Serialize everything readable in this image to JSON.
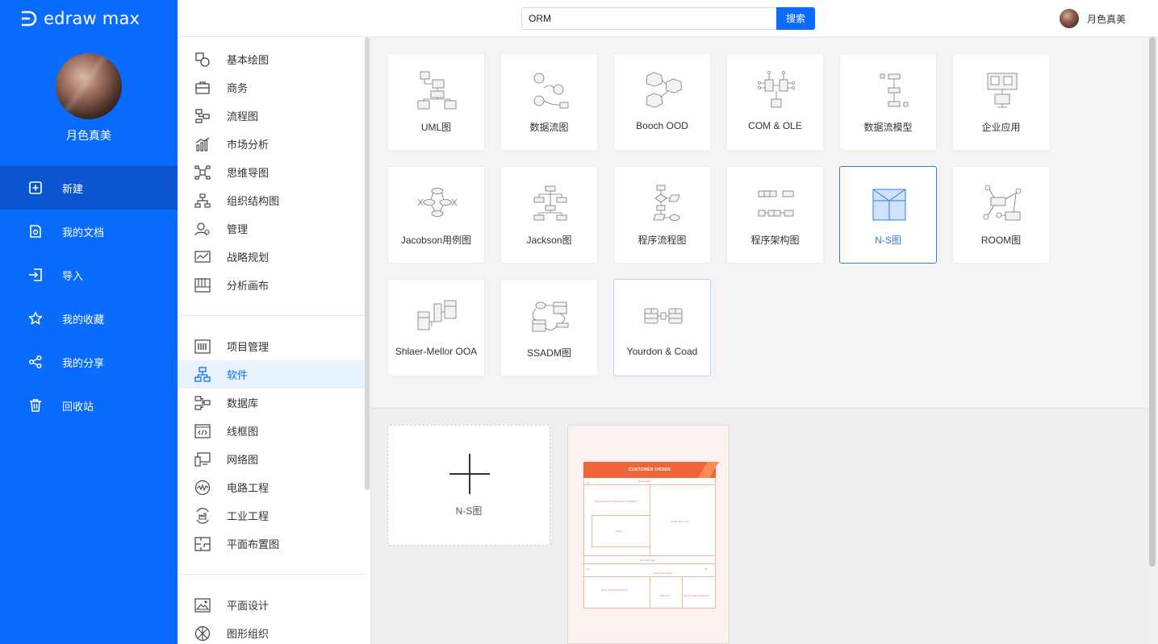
{
  "app": {
    "logo_text": "edraw max",
    "username": "月色真美"
  },
  "nav": {
    "items": [
      {
        "label": "新建",
        "icon": "new-file-icon",
        "active": true
      },
      {
        "label": "我的文档",
        "icon": "document-icon",
        "active": false
      },
      {
        "label": "导入",
        "icon": "import-icon",
        "active": false
      },
      {
        "label": "我的收藏",
        "icon": "star-icon",
        "active": false
      },
      {
        "label": "我的分享",
        "icon": "share-icon",
        "active": false
      },
      {
        "label": "回收站",
        "icon": "trash-icon",
        "active": false
      }
    ]
  },
  "topbar": {
    "search_value": "ORM",
    "search_button": "搜索",
    "username": "月色真美"
  },
  "categories": {
    "group1": [
      "基本绘图",
      "商务",
      "流程图",
      "市场分析",
      "思维导图",
      "组织结构图",
      "管理",
      "战略规划",
      "分析画布"
    ],
    "group2": [
      "项目管理",
      "软件",
      "数据库",
      "线框图",
      "网络图",
      "电路工程",
      "工业工程",
      "平面布置图"
    ],
    "group3": [
      "平面设计",
      "图形组织"
    ],
    "active": "软件"
  },
  "templates": {
    "row1": [
      "UML图",
      "数据流图",
      "Booch OOD",
      "COM & OLE",
      "数据流模型",
      "企业应用"
    ],
    "row2": [
      "Jacobson用例图",
      "Jackson图",
      "程序流程图",
      "程序架构图",
      "N-S图",
      "ROOM图"
    ],
    "row3": [
      "Shlaer-Mellor OOA",
      "SSADM图",
      "Yourdon & Coad"
    ],
    "selected": "N-S图"
  },
  "new_blank": {
    "label": "N-S图"
  },
  "preview": {
    "title": "CUSTOMER ORDER",
    "texts": [
      "Read Order",
      "Yes",
      "Verify Customer Information Is Updated",
      "Query",
      "Create Document",
      "Set Total Price",
      "Credit Card Valid?",
      "Yes",
      "No",
      "Send e-mail to customer",
      "Ship item",
      "Send e-mail to customer"
    ]
  },
  "colors": {
    "brand": "#0a6cff",
    "nav_active": "#0a56d0",
    "selected_border": "#2f7de8",
    "preview_header": "#f0643a"
  }
}
